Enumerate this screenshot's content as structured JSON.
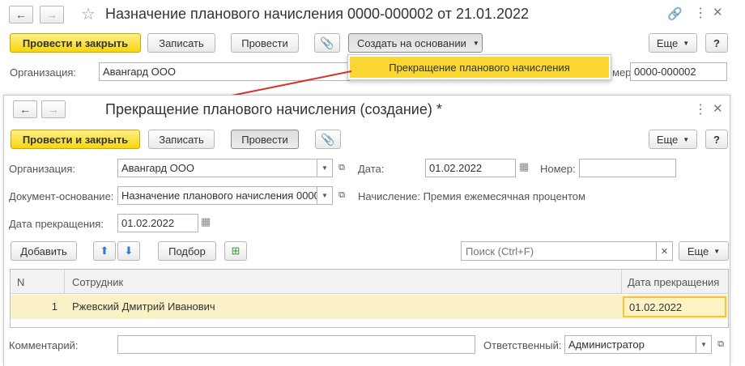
{
  "bg_window": {
    "title": "Назначение планового начисления 0000-000002 от 21.01.2022",
    "post_close_label": "Провести и закрыть",
    "save_label": "Записать",
    "post_label": "Провести",
    "create_based_label": "Создать на основании",
    "more_label": "Еще",
    "help_label": "?",
    "org_label": "Организация:",
    "org_value": "Авангард ООО",
    "number_label_partial": "мер:",
    "number_value": "0000-000002"
  },
  "dropdown": {
    "item_label": "Прекращение планового начисления"
  },
  "fg_window": {
    "title": "Прекращение планового начисления (создание) *",
    "post_close_label": "Провести и закрыть",
    "save_label": "Записать",
    "post_label": "Провести",
    "more_label": "Еще",
    "help_label": "?",
    "org_label": "Организация:",
    "org_value": "Авангард ООО",
    "date_label": "Дата:",
    "date_value": "01.02.2022",
    "number_label": "Номер:",
    "number_value": "",
    "base_doc_label": "Документ-основание:",
    "base_doc_value": "Назначение планового начисления 0000",
    "accrual_text": "Начисление: Премия ежемесячная процентом",
    "end_date_label": "Дата прекращения:",
    "end_date_value": "01.02.2022",
    "add_label": "Добавить",
    "pick_label": "Подбор",
    "search_placeholder": "Поиск (Ctrl+F)",
    "table_more_label": "Еще",
    "table": {
      "headers": [
        "N",
        "Сотрудник",
        "Дата прекращения"
      ],
      "rows": [
        {
          "n": "1",
          "employee": "Ржевский Дмитрий Иванович",
          "end_date": "01.02.2022"
        }
      ]
    },
    "comment_label": "Комментарий:",
    "comment_value": "",
    "responsible_label": "Ответственный:",
    "responsible_value": "Администратор"
  },
  "colors": {
    "accent_yellow": "#f5d60e",
    "selected_row": "#fbf1c6",
    "arrow_red": "#d9322b"
  }
}
